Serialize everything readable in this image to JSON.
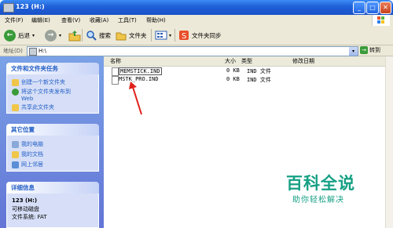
{
  "window": {
    "title": "123 (H:)"
  },
  "menu": [
    "文件(F)",
    "编辑(E)",
    "查看(V)",
    "收藏(A)",
    "工具(T)",
    "帮助(H)"
  ],
  "toolbar": {
    "back": "后退",
    "search": "搜索",
    "folders": "文件夹",
    "sync": "文件夹同步"
  },
  "address": {
    "label": "地址(D)",
    "value": "H:\\",
    "go": "转到"
  },
  "tasks": {
    "title": "文件和文件夹任务",
    "items": [
      "创建一个新文件夹",
      "将这个文件夹发布到",
      "Web",
      "共享此文件夹"
    ]
  },
  "places": {
    "title": "其它位置",
    "items": [
      "我的电脑",
      "我的文档",
      "网上邻居"
    ]
  },
  "details": {
    "title": "详细信息",
    "name": "123 (H:)",
    "type": "可移动磁盘",
    "fs": "文件系统: FAT"
  },
  "columns": {
    "name": "名称",
    "size": "大小",
    "type": "类型",
    "modified": "修改日期"
  },
  "files": [
    {
      "name": "MEMSTICK.IND",
      "size": "0 KB",
      "type": "IND 文件"
    },
    {
      "name": "MSTK_PRO.IND",
      "size": "0 KB",
      "type": "IND 文件"
    }
  ],
  "watermark": {
    "title": "百科全说",
    "subtitle": "助你轻松解决"
  }
}
